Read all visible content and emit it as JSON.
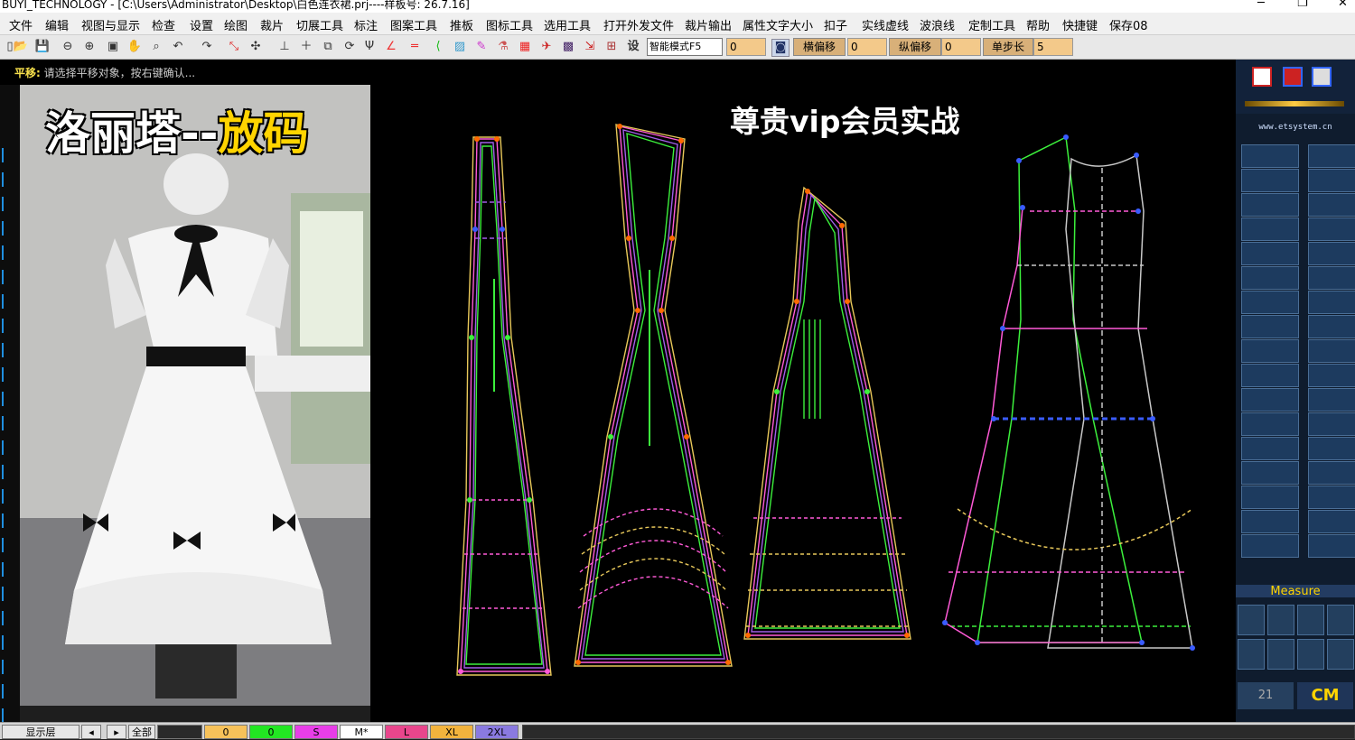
{
  "window": {
    "title": "BUYI_TECHNOLOGY - [C:\\Users\\Administrator\\Desktop\\白色连衣裙.prj----样板号: 26.7.16]",
    "controls": [
      "─",
      "❐",
      "✕"
    ]
  },
  "menu": [
    "文件",
    "编辑",
    "视图与显示",
    "检查",
    "设置",
    "绘图",
    "裁片",
    "切展工具",
    "标注",
    "图案工具",
    "推板",
    "图标工具",
    "选用工具",
    "打开外发文件",
    "裁片输出",
    "属性文字大小",
    "扣子",
    "实线虚线",
    "波浪线",
    "定制工具",
    "帮助",
    "快捷键",
    "保存08"
  ],
  "toolbar": {
    "mode_select": "智能模式F5",
    "field1": "0",
    "h_offset_label": "横偏移",
    "h_offset_value": "0",
    "v_offset_label": "纵偏移",
    "v_offset_value": "0",
    "step_label": "单步长",
    "step_value": "5"
  },
  "status": {
    "prefix": "平移:",
    "message": "请选择平移对象，按右键确认..."
  },
  "overlay": {
    "title_white": "洛丽塔--",
    "title_yellow": "放码",
    "vip_text": "尊贵vip会员实战"
  },
  "right_panel": {
    "url": "www.etsystem.cn",
    "measure_label": "Measure",
    "unit_num": "21",
    "unit": "CM"
  },
  "bottom": {
    "layer_label": "显示层",
    "all_label": "全部",
    "sizes": [
      {
        "label": "0",
        "color": "#f7c25a"
      },
      {
        "label": "0",
        "color": "#22e622"
      },
      {
        "label": "S",
        "color": "#e83ee8"
      },
      {
        "label": "M*",
        "color": "#ffffff"
      },
      {
        "label": "L",
        "color": "#e8468c"
      },
      {
        "label": "XL",
        "color": "#f2b33d"
      },
      {
        "label": "2XL",
        "color": "#8a7ae0"
      }
    ]
  },
  "colors": {
    "canvas_bg": "#000000",
    "pattern_pink": "#ff5ad7",
    "pattern_yellow": "#e8c85a",
    "pattern_green": "#3cf03c",
    "pattern_violet": "#a25ee8",
    "pattern_blue": "#3a5cff"
  }
}
